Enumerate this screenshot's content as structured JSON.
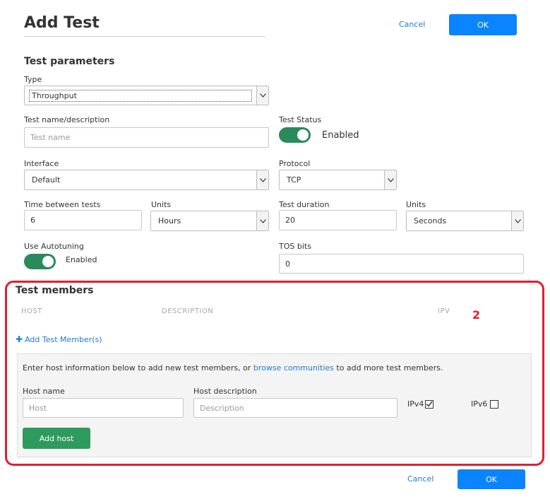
{
  "header": {
    "title": "Add Test",
    "cancel_label": "Cancel",
    "ok_label": "OK"
  },
  "params": {
    "section_title": "Test parameters",
    "type": {
      "label": "Type",
      "value": "Throughput"
    },
    "test_name": {
      "label": "Test name/description",
      "placeholder": "Test name"
    },
    "test_status": {
      "label": "Test Status",
      "value": "Enabled"
    },
    "interface": {
      "label": "Interface",
      "value": "Default"
    },
    "protocol": {
      "label": "Protocol",
      "value": "TCP"
    },
    "time_between": {
      "label": "Time between tests",
      "value": "6"
    },
    "units_time": {
      "label": "Units",
      "value": "Hours"
    },
    "duration": {
      "label": "Test duration",
      "value": "20"
    },
    "units_duration": {
      "label": "Units",
      "value": "Seconds"
    },
    "autotuning": {
      "label": "Use Autotuning",
      "value": "Enabled"
    },
    "tos": {
      "label": "TOS bits",
      "value": "0"
    }
  },
  "members": {
    "section_title": "Test members",
    "columns": [
      "HOST",
      "DESCRIPTION",
      "IPV"
    ],
    "annotation_number": "2",
    "add_link": "Add Test Member(s)",
    "info_prefix": "Enter host information below to add new test members, or ",
    "info_link": "browse communities",
    "info_suffix": " to add more test members.",
    "host_name": {
      "label": "Host name",
      "placeholder": "Host"
    },
    "host_desc": {
      "label": "Host description",
      "placeholder": "Description"
    },
    "ipv4": {
      "label": "IPv4",
      "checked": true
    },
    "ipv6": {
      "label": "IPv6",
      "checked": false
    },
    "add_host_label": "Add host"
  },
  "footer": {
    "cancel_label": "Cancel",
    "ok_label": "OK"
  },
  "colors": {
    "primary": "#0a84ff",
    "toggle_on": "#2a8a5c",
    "add_host": "#2f9a5e",
    "highlight": "#e0202f",
    "link": "#1e7bd2"
  }
}
